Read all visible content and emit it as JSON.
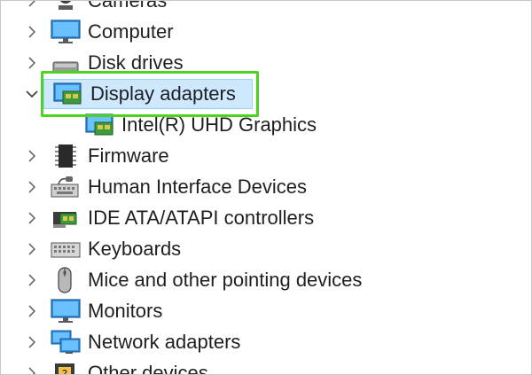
{
  "device_manager": {
    "items": [
      {
        "label": "Cameras",
        "icon": "camera-icon",
        "expanded": false
      },
      {
        "label": "Computer",
        "icon": "computer-monitor-icon",
        "expanded": false
      },
      {
        "label": "Disk drives",
        "icon": "disk-drive-icon",
        "expanded": false
      },
      {
        "label": "Display adapters",
        "icon": "display-adapter-icon",
        "expanded": true,
        "selected": true
      },
      {
        "label": "Intel(R) UHD Graphics",
        "icon": "display-adapter-icon",
        "child": true
      },
      {
        "label": "Firmware",
        "icon": "firmware-chip-icon",
        "expanded": false
      },
      {
        "label": "Human Interface Devices",
        "icon": "hid-keyboard-icon",
        "expanded": false
      },
      {
        "label": "IDE ATA/ATAPI controllers",
        "icon": "ide-controller-icon",
        "expanded": false
      },
      {
        "label": "Keyboards",
        "icon": "keyboard-icon",
        "expanded": false
      },
      {
        "label": "Mice and other pointing devices",
        "icon": "mouse-icon",
        "expanded": false
      },
      {
        "label": "Monitors",
        "icon": "monitor-icon",
        "expanded": false
      },
      {
        "label": "Network adapters",
        "icon": "network-adapter-icon",
        "expanded": false
      },
      {
        "label": "Other devices",
        "icon": "other-devices-icon",
        "expanded": false
      }
    ]
  },
  "colors": {
    "selection_fill": "#cde8ff",
    "selection_border": "#99d1ff",
    "annotation_highlight": "#4ad320"
  }
}
